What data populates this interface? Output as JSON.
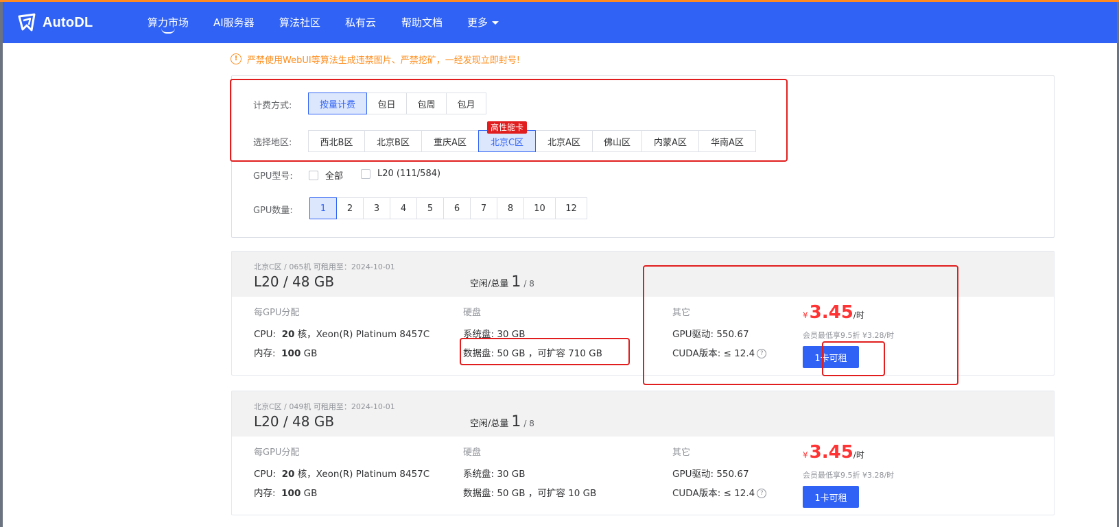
{
  "brand": {
    "name": "AutoDL",
    "logo_icon": "autodl-logo-icon"
  },
  "nav": {
    "items": [
      {
        "label": "算力市场",
        "active": true
      },
      {
        "label": "AI服务器"
      },
      {
        "label": "算法社区"
      },
      {
        "label": "私有云"
      },
      {
        "label": "帮助文档"
      },
      {
        "label": "更多"
      }
    ]
  },
  "notice": {
    "text": "严禁使用WebUI等算法生成违禁图片、严禁挖矿，一经发现立即封号!"
  },
  "filters": {
    "billing": {
      "label": "计费方式:",
      "options": [
        "按量计费",
        "包日",
        "包周",
        "包月"
      ],
      "selected": "按量计费"
    },
    "region": {
      "label": "选择地区:",
      "options": [
        "西北B区",
        "北京B区",
        "重庆A区",
        "北京C区",
        "北京A区",
        "佛山区",
        "内蒙A区",
        "华南A区"
      ],
      "selected": "北京C区",
      "badge": "高性能卡"
    },
    "gpu_model": {
      "label": "GPU型号:",
      "options": [
        "全部",
        "L20 (111/584)"
      ]
    },
    "gpu_count": {
      "label": "GPU数量:",
      "options": [
        "1",
        "2",
        "3",
        "4",
        "5",
        "6",
        "7",
        "8",
        "10",
        "12"
      ],
      "selected": "1"
    }
  },
  "machines": [
    {
      "meta": "北京C区 / 065机   可租用至：2024-10-01",
      "title": "L20 / 48 GB",
      "free_label": "空闲/总量",
      "free": "1",
      "total": "/ 8",
      "per_gpu_title": "每GPU分配",
      "cpu_label": "CPU:",
      "cpu_cores": "20",
      "cpu_suffix": "核，Xeon(R) Platinum 8457C",
      "mem_label": "内存:",
      "mem_value": "100",
      "mem_unit": "GB",
      "disk_title": "硬盘",
      "sys_disk": "系统盘:  30 GB",
      "data_disk": "数据盘:  50 GB ，可扩容 710 GB",
      "other_title": "其它",
      "driver": "GPU驱动:  550.67",
      "cuda": "CUDA版本:  ≤ 12.4",
      "price_symbol": "¥",
      "price": "3.45",
      "price_unit": "/时",
      "member_price": "会员最低享9.5折 ¥3.28/时",
      "rent_button": "1卡可租"
    },
    {
      "meta": "北京C区 / 049机   可租用至：2024-10-01",
      "title": "L20 / 48 GB",
      "free_label": "空闲/总量",
      "free": "1",
      "total": "/ 8",
      "per_gpu_title": "每GPU分配",
      "cpu_label": "CPU:",
      "cpu_cores": "20",
      "cpu_suffix": "核，Xeon(R) Platinum 8457C",
      "mem_label": "内存:",
      "mem_value": "100",
      "mem_unit": "GB",
      "disk_title": "硬盘",
      "sys_disk": "系统盘:  30 GB",
      "data_disk": "数据盘:  50 GB ，可扩容 10 GB",
      "other_title": "其它",
      "driver": "GPU驱动:  550.67",
      "cuda": "CUDA版本:  ≤ 12.4",
      "price_symbol": "¥",
      "price": "3.45",
      "price_unit": "/时",
      "member_price": "会员最低享9.5折 ¥3.28/时",
      "rent_button": "1卡可租"
    }
  ],
  "colors": {
    "nav_bg": "#3063f5",
    "accent": "#3063f5",
    "price": "#ff3333",
    "warning": "#ff8c1a",
    "highlight_box": "#e11d1d"
  }
}
